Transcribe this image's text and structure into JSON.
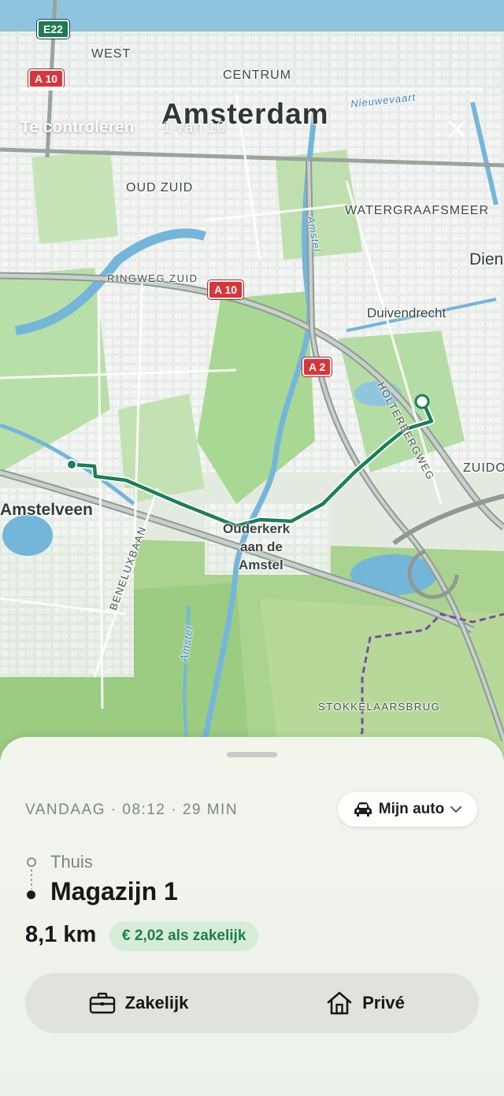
{
  "map": {
    "city": "Amsterdam",
    "districts": [
      "WEST",
      "CENTRUM",
      "OUD ZUID",
      "WATERGRAAFSMEER"
    ],
    "towns": [
      "Amstelveen",
      "Ouderkerk",
      "aan de",
      "Amstel",
      "Duivendrecht",
      "Dien",
      "ZUIDOO"
    ],
    "roads": [
      "RINGWEG ZUID",
      "HOLTERBERGWEG",
      "BENELUXBAAN",
      "STOKKELAARSBRUG"
    ],
    "water": [
      "Nieuwevaart",
      "Amstel",
      "Amstel",
      "Amstel"
    ],
    "shields": [
      "E22",
      "A 10",
      "A 10",
      "A 2"
    ]
  },
  "topbar": {
    "title": "Te controleren",
    "counter": "1 van 10",
    "progress_fraction": 0.1
  },
  "trip": {
    "meta": "VANDAAG · 08:12 · 29 MIN",
    "vehicle_label": "Mijn auto",
    "origin": "Thuis",
    "destination": "Magazijn 1",
    "distance": "8,1 km",
    "allowance": "€ 2,02 als zakelijk"
  },
  "actions": {
    "business_label": "Zakelijk",
    "private_label": "Privé"
  },
  "colors": {
    "route": "#1c7f57",
    "allowance_bg": "#d6ecd9",
    "allowance_text": "#1e7e4c"
  }
}
